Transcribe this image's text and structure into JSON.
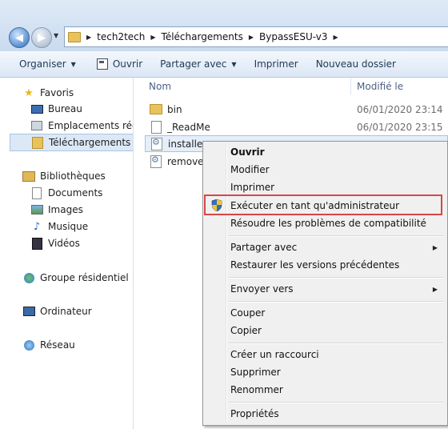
{
  "address": {
    "crumbs": [
      "tech2tech",
      "Téléchargements",
      "BypassESU-v3"
    ],
    "separator": "▶"
  },
  "commandbar": {
    "organiser": "Organiser",
    "ouvrir": "Ouvrir",
    "partager": "Partager avec",
    "imprimer": "Imprimer",
    "nouveau_dossier": "Nouveau dossier"
  },
  "nav": {
    "favoris": "Favoris",
    "bureau": "Bureau",
    "emplacements": "Emplacements récen",
    "telechargements": "Téléchargements",
    "bibliotheques": "Bibliothèques",
    "documents": "Documents",
    "images": "Images",
    "musique": "Musique",
    "videos": "Vidéos",
    "groupe": "Groupe résidentiel",
    "ordinateur": "Ordinateur",
    "reseau": "Réseau"
  },
  "columns": {
    "name": "Nom",
    "modified": "Modifié le"
  },
  "files": [
    {
      "name": "bin",
      "date": "06/01/2020 23:14"
    },
    {
      "name": "_ReadMe",
      "date": "06/01/2020 23:15"
    },
    {
      "name": "installer",
      "date": ""
    },
    {
      "name": "remover",
      "date": ""
    }
  ],
  "menu": {
    "ouvrir": "Ouvrir",
    "modifier": "Modifier",
    "imprimer": "Imprimer",
    "executer_admin": "Exécuter en tant qu'administrateur",
    "resoudre": "Résoudre les problèmes de compatibilité",
    "partager": "Partager avec",
    "restaurer": "Restaurer les versions précédentes",
    "envoyer": "Envoyer vers",
    "couper": "Couper",
    "copier": "Copier",
    "raccourci": "Créer un raccourci",
    "supprimer": "Supprimer",
    "renommer": "Renommer",
    "proprietes": "Propriétés"
  },
  "icons": {
    "back": "back-arrow-icon",
    "forward": "forward-arrow-icon",
    "shield": "uac-shield-icon"
  },
  "colors": {
    "highlight_border": "#d84646",
    "selection": "#dce8f6"
  }
}
